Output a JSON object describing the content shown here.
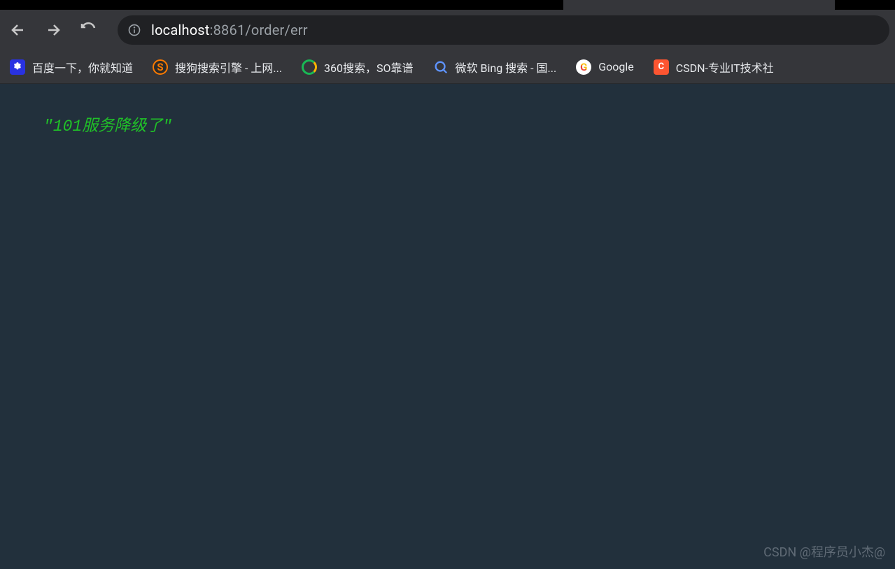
{
  "toolbar": {
    "url": {
      "host": "localhost",
      "port_path": ":8861/order/err"
    }
  },
  "bookmarks": [
    {
      "label": "百度一下，你就知道",
      "icon": "baidu"
    },
    {
      "label": "搜狗搜索引擎 - 上网...",
      "icon": "sogou"
    },
    {
      "label": "360搜索，SO靠谱",
      "icon": "360"
    },
    {
      "label": "微软 Bing 搜索 - 国...",
      "icon": "bing"
    },
    {
      "label": "Google",
      "icon": "google"
    },
    {
      "label": "CSDN-专业IT技术社",
      "icon": "csdn"
    }
  ],
  "page": {
    "response_body": "\"101服务降级了\""
  },
  "watermark": "CSDN @程序员小杰@"
}
